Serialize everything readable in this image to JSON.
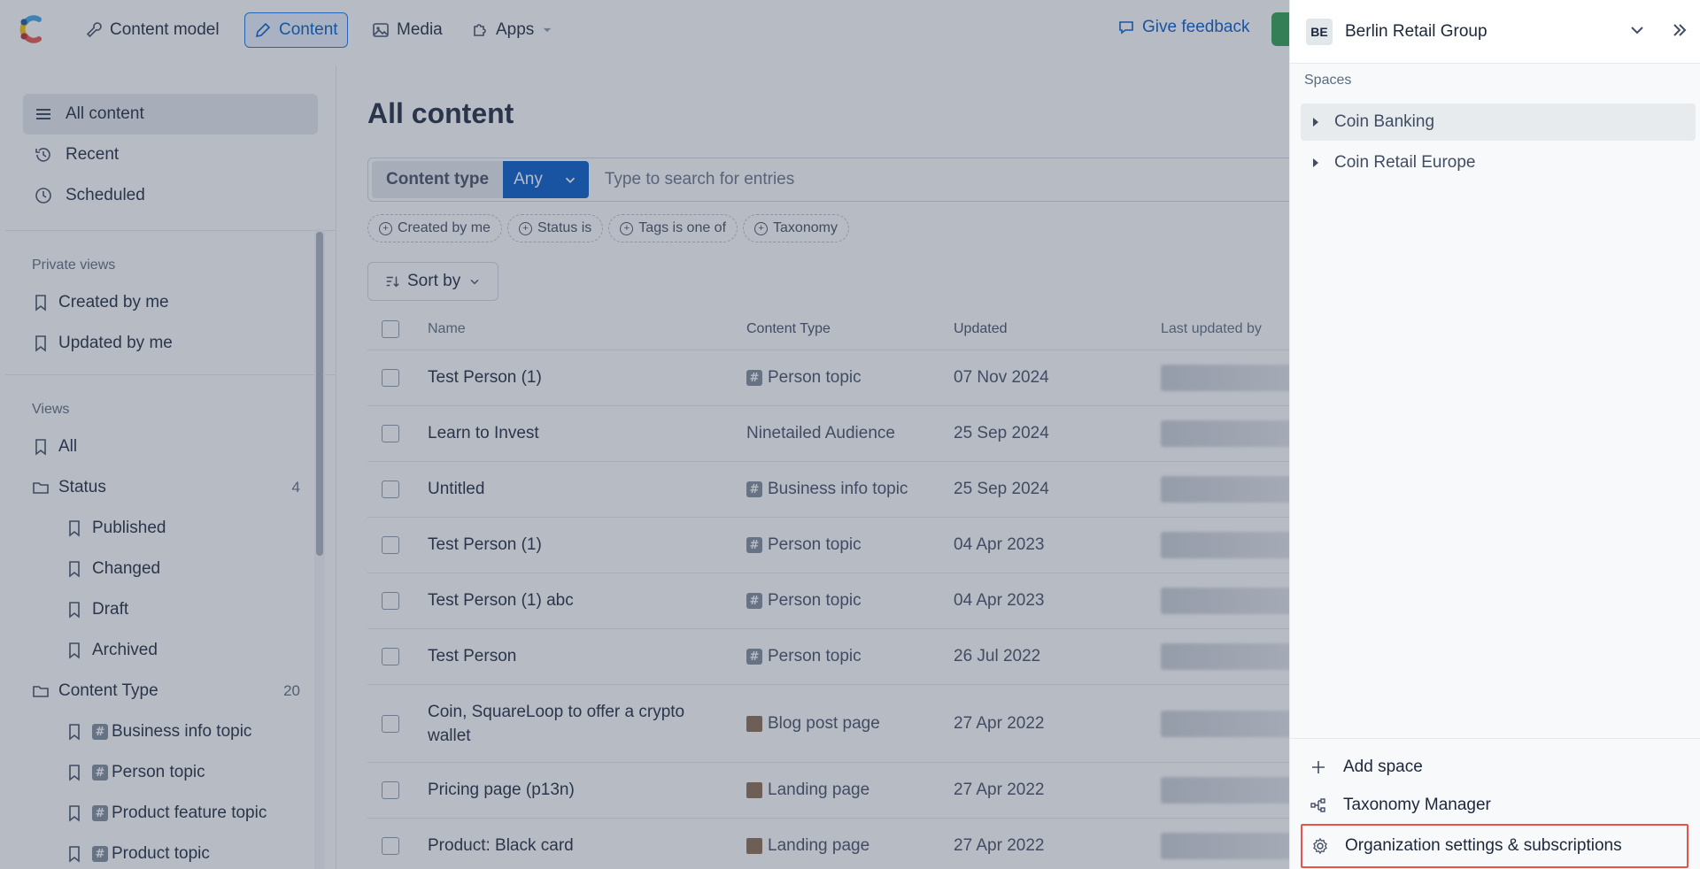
{
  "topnav": {
    "content_model": "Content model",
    "content": "Content",
    "media": "Media",
    "apps": "Apps",
    "feedback": "Give feedback"
  },
  "sidebar": {
    "all_content": "All content",
    "recent": "Recent",
    "scheduled": "Scheduled",
    "private_views_label": "Private views",
    "created_by_me": "Created by me",
    "updated_by_me": "Updated by me",
    "views_label": "Views",
    "all": "All",
    "status": "Status",
    "status_count": "4",
    "published": "Published",
    "changed": "Changed",
    "draft": "Draft",
    "archived": "Archived",
    "content_type": "Content Type",
    "content_type_count": "20",
    "ct_items": [
      "Business info topic",
      "Person topic",
      "Product feature topic",
      "Product topic"
    ]
  },
  "main": {
    "title": "All content",
    "content_type_label": "Content type",
    "any_label": "Any",
    "search_placeholder": "Type to search for entries",
    "filters": [
      "Created by me",
      "Status is",
      "Tags is one of",
      "Taxonomy"
    ],
    "sort_label": "Sort by",
    "columns": [
      "Name",
      "Content Type",
      "Updated",
      "Last updated by"
    ],
    "rows": [
      {
        "name": "Test Person (1)",
        "type": "Person topic",
        "icon": "hash",
        "updated": "07 Nov 2024"
      },
      {
        "name": "Learn to Invest",
        "type": "Ninetailed Audience",
        "icon": "none",
        "updated": "25 Sep 2024"
      },
      {
        "name": "Untitled",
        "type": "Business info topic",
        "icon": "hash",
        "updated": "25 Sep 2024"
      },
      {
        "name": "Test Person (1)",
        "type": "Person topic",
        "icon": "hash",
        "updated": "04 Apr 2023"
      },
      {
        "name": "Test Person (1) abc",
        "type": "Person topic",
        "icon": "hash",
        "updated": "04 Apr 2023"
      },
      {
        "name": "Test Person",
        "type": "Person topic",
        "icon": "hash",
        "updated": "26 Jul 2022"
      },
      {
        "name": "Coin, SquareLoop to offer a crypto wallet",
        "type": "Blog post page",
        "icon": "page",
        "updated": "27 Apr 2022"
      },
      {
        "name": "Pricing page (p13n)",
        "type": "Landing page",
        "icon": "page",
        "updated": "27 Apr 2022"
      },
      {
        "name": "Product: Black card",
        "type": "Landing page",
        "icon": "page",
        "updated": "27 Apr 2022"
      }
    ]
  },
  "panel": {
    "org_initials": "BE",
    "org_name": "Berlin Retail Group",
    "spaces_label": "Spaces",
    "spaces": [
      "Coin Banking",
      "Coin Retail Europe"
    ],
    "add_space": "Add space",
    "taxonomy_manager": "Taxonomy Manager",
    "org_settings": "Organization settings & subscriptions"
  },
  "colors": {
    "accent": "#0059c8",
    "highlight_box": "#e8534a"
  }
}
